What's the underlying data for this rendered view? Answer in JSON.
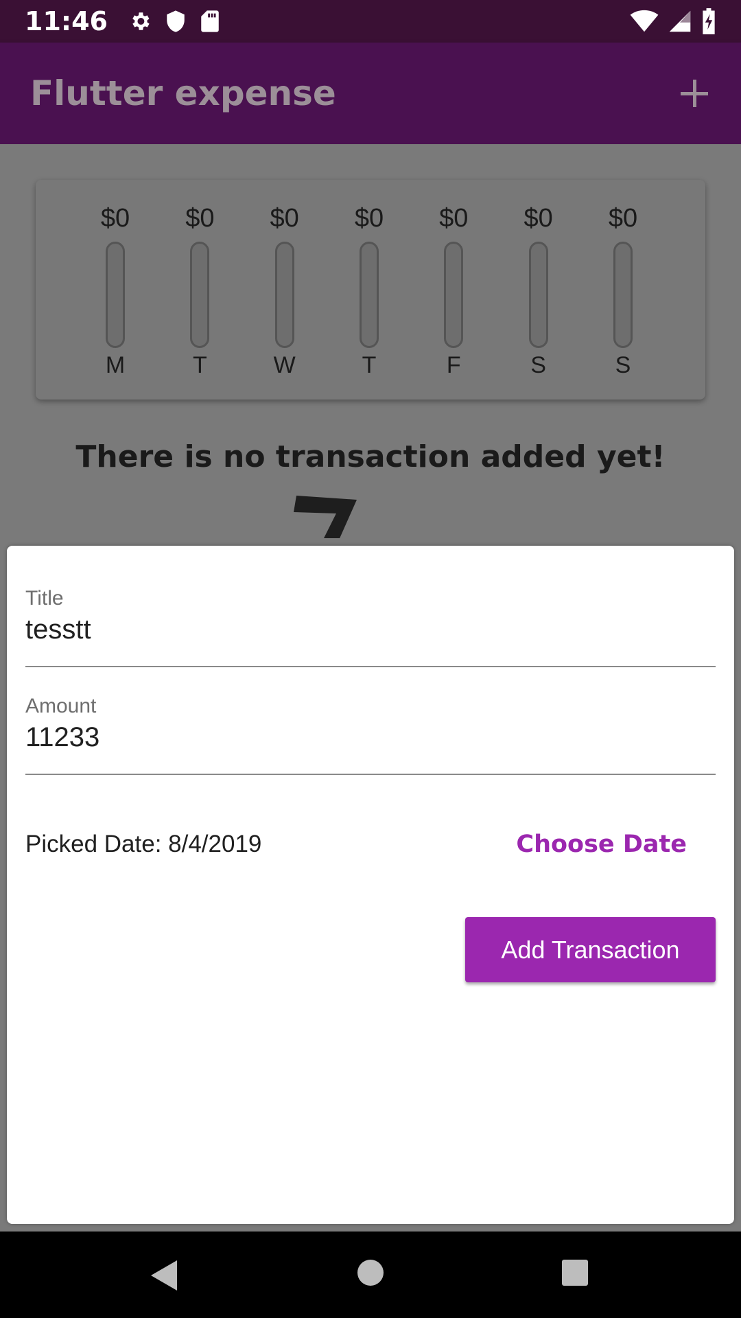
{
  "status_bar": {
    "time": "11:46",
    "left_icons": [
      "settings-icon",
      "shield-icon",
      "sd-card-icon"
    ],
    "right_icons": [
      "wifi-icon",
      "cell-signal-icon",
      "battery-charging-icon"
    ]
  },
  "app_bar": {
    "title": "Flutter expense",
    "action_icon": "add-icon"
  },
  "chart": {
    "days": [
      {
        "day": "M",
        "amount": "$0",
        "fill_fraction": 0
      },
      {
        "day": "T",
        "amount": "$0",
        "fill_fraction": 0
      },
      {
        "day": "W",
        "amount": "$0",
        "fill_fraction": 0
      },
      {
        "day": "T",
        "amount": "$0",
        "fill_fraction": 0
      },
      {
        "day": "F",
        "amount": "$0",
        "fill_fraction": 0
      },
      {
        "day": "S",
        "amount": "$0",
        "fill_fraction": 0
      },
      {
        "day": "S",
        "amount": "$0",
        "fill_fraction": 0
      }
    ]
  },
  "empty_state": {
    "message": "There is no transaction added yet!"
  },
  "form": {
    "title_label": "Title",
    "title_value": "tesstt",
    "amount_label": "Amount",
    "amount_value": "11233",
    "picked_date": "Picked Date: 8/4/2019",
    "choose_date_label": "Choose Date",
    "submit_label": "Add Transaction"
  },
  "colors": {
    "accent": "#9b27af",
    "app_bar": "#4a1150",
    "status_bar": "#3a1034"
  }
}
